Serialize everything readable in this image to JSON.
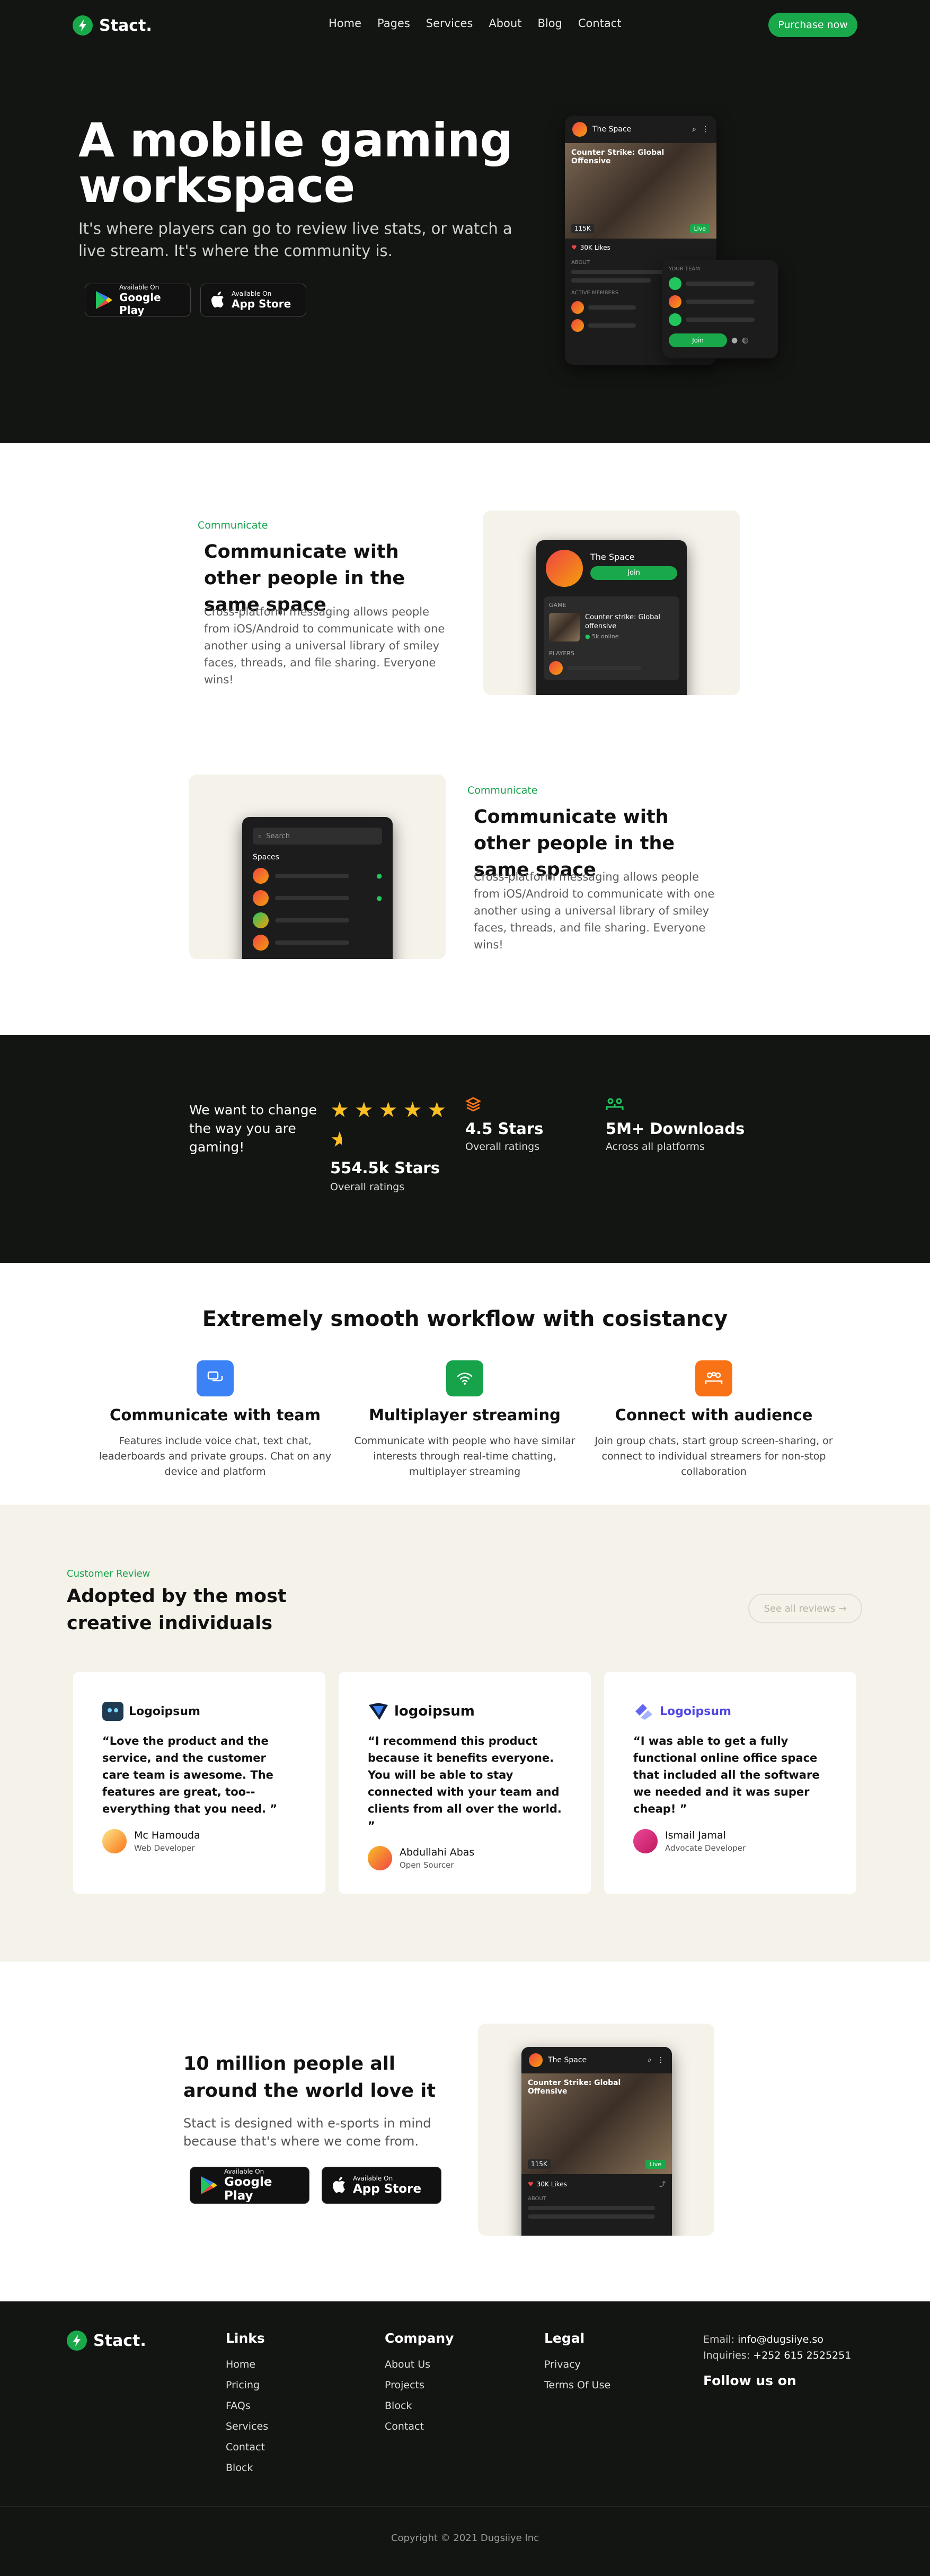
{
  "nav": {
    "brand": "Stact.",
    "links": [
      "Home",
      "Pages",
      "Services",
      "About",
      "Blog",
      "Contact"
    ],
    "cta": "Purchase now"
  },
  "hero": {
    "title": "A mobile gaming workspace",
    "subtitle": "It's where players can go to review live stats, or watch a live stream. It's where the community is.",
    "google": {
      "small": "Available On",
      "big": "Google Play"
    },
    "apple": {
      "small": "Available On",
      "big": "App Store"
    },
    "mock": {
      "space": "The Space",
      "game": "Counter Strike: Global Offensive",
      "live": "Live",
      "views": "115K",
      "likes": "30K Likes",
      "about": "ABOUT",
      "active": "ACTIVE MEMBERS",
      "team": "YOUR TEAM",
      "join": "Join"
    }
  },
  "feature1": {
    "tag": "Communicate",
    "title": "Communicate with other people in the same space",
    "text": "Cross-platform messaging allows people from iOS/Android to communicate with one another using a universal library of smiley faces, threads, and file sharing. Everyone wins!",
    "mock": {
      "space": "The Space",
      "join": "Join",
      "game_label": "GAME",
      "game": "Counter strike: Global offensive",
      "online": "5k online",
      "players": "PLAYERS"
    }
  },
  "feature2": {
    "tag": "Communicate",
    "title": "Communicate with other people in the same space",
    "text": "Cross-platform messaging allows people from iOS/Android to communicate with one another using a universal library of smiley faces, threads, and file sharing. Everyone wins!",
    "mock": {
      "search": "Search",
      "spaces": "Spaces"
    }
  },
  "stats": {
    "intro": "We want to change the way you are gaming!",
    "s1": {
      "value": "554.5k Stars",
      "label": "Overall ratings"
    },
    "s2": {
      "value": "4.5 Stars",
      "label": "Overall ratings"
    },
    "s3": {
      "value": "5M+ Downloads",
      "label": "Across all platforms"
    },
    "rating_stars": 5.5
  },
  "workflow": {
    "title": "Extremely smooth workflow with cosistancy",
    "items": [
      {
        "title": "Communicate with team",
        "text": "Features include voice chat, text chat, leaderboards and private groups. Chat on any device and platform",
        "color": "#3b82f6"
      },
      {
        "title": "Multiplayer streaming",
        "text": "Communicate with people who have similar interests through real-time chatting, multiplayer streaming",
        "color": "#16a34a"
      },
      {
        "title": "Connect with audience",
        "text": "Join group chats, start group screen-sharing, or connect to individual streamers for non-stop collaboration",
        "color": "#f97316"
      }
    ]
  },
  "reviews": {
    "tag": "Customer Review",
    "title": "Adopted by the most creative individuals",
    "see_all": "See all reviews",
    "items": [
      {
        "logo": "Logoipsum",
        "quote": "“Love the product and the service, and the customer care team is awesome. The features are great, too--everything that you need. ”",
        "name": "Mc Hamouda",
        "role": "Web Developer"
      },
      {
        "logo": "logoipsum",
        "quote": "“I recommend this product because it benefits everyone. You will be able to stay connected with your team and clients from all over the world. ”",
        "name": "Abdullahi Abas",
        "role": "Open Sourcer"
      },
      {
        "logo": "Logoipsum",
        "quote": "“I was able to get a fully functional online office space that included all the software we needed and it was super cheap! ”",
        "name": "Ismail Jamal",
        "role": "Advocate Developer"
      }
    ]
  },
  "cta": {
    "title": "10 million people all around the world love it",
    "text": "Stact is designed with e-sports in mind because that's where we come from.",
    "google": {
      "small": "Available On",
      "big": "Google Play"
    },
    "apple": {
      "small": "Available On",
      "big": "App Store"
    },
    "mock": {
      "space": "The Space",
      "game": "Counter Strike: Global Offensive",
      "views": "115K",
      "live": "Live",
      "likes": "30K Likes",
      "about": "ABOUT"
    }
  },
  "footer": {
    "brand": "Stact.",
    "links_title": "Links",
    "links": [
      "Home",
      "Pricing",
      "FAQs",
      "Services",
      "Contact",
      "Block"
    ],
    "company_title": "Company",
    "company": [
      "About Us",
      "Projects",
      "Block",
      "Contact"
    ],
    "legal_title": "Legal",
    "legal": [
      "Privacy",
      "Terms Of Use"
    ],
    "email_label": "Email:",
    "email": "info@dugsiiye.so",
    "inquiries_label": "Inquiries:",
    "phone": "+252 615 2525251",
    "follow": "Follow us on",
    "copyright": "Copyright © 2021 Dugsiiye Inc"
  },
  "colors": {
    "accent": "#19a94a",
    "dark": "#131512",
    "cream": "#f5f2ea"
  }
}
